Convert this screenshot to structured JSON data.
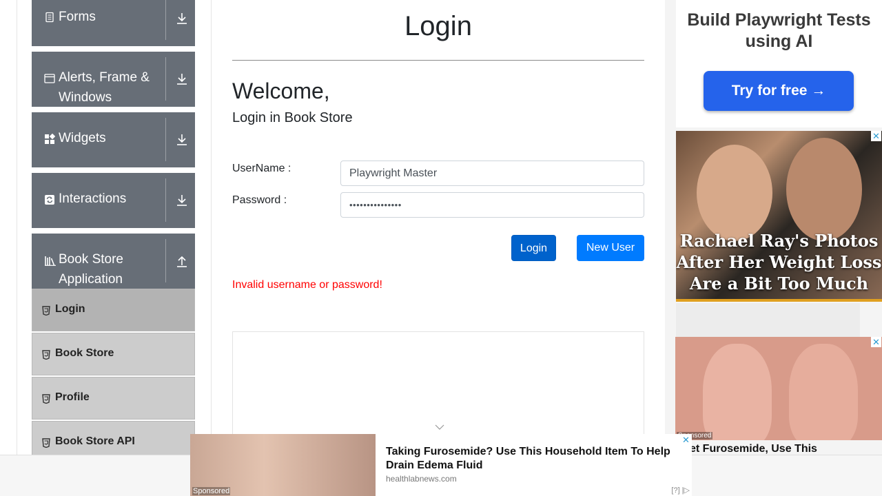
{
  "sidebar": {
    "groups": [
      {
        "label": "Forms",
        "icon": "document-icon",
        "toggle": "down"
      },
      {
        "label": "Alerts, Frame & Windows",
        "icon": "window-icon",
        "toggle": "down"
      },
      {
        "label": "Widgets",
        "icon": "widgets-icon",
        "toggle": "down"
      },
      {
        "label": "Interactions",
        "icon": "interactions-icon",
        "toggle": "down"
      },
      {
        "label": "Book Store Application",
        "icon": "books-icon",
        "toggle": "up"
      }
    ],
    "items": [
      {
        "label": "Login",
        "active": true
      },
      {
        "label": "Book Store"
      },
      {
        "label": "Profile"
      },
      {
        "label": "Book Store API"
      }
    ]
  },
  "main": {
    "title": "Login",
    "welcome": "Welcome,",
    "subtitle": "Login in Book Store",
    "username_label": "UserName :",
    "username_value": "Playwright Master",
    "password_label": "Password :",
    "password_value": "•••••••••••••••",
    "login_button": "Login",
    "new_user_button": "New User",
    "error": "Invalid username or password!"
  },
  "ads": {
    "ad1_title": "Build Playwright Tests using AI",
    "ad1_cta": "Try for free →",
    "ad2_headline": "Rachael Ray's Photos After Her Weight Loss Are a Bit Too Much",
    "ad3_sponsored": "Sponsored",
    "ad3_text": "rget Furosemide, Use This",
    "close_glyph": "✕",
    "bottom_sponsored": "Sponsored",
    "bottom_headline": "Taking Furosemide? Use This Household Item To Help Drain Edema Fluid",
    "bottom_source": "healthlabnews.com",
    "bottom_adinfo": "[?] |▷"
  },
  "colors": {
    "sidebar_group_bg": "#676e77",
    "sidebar_item_bg": "#cccccc",
    "primary": "#007bff",
    "error": "#ff0000"
  }
}
